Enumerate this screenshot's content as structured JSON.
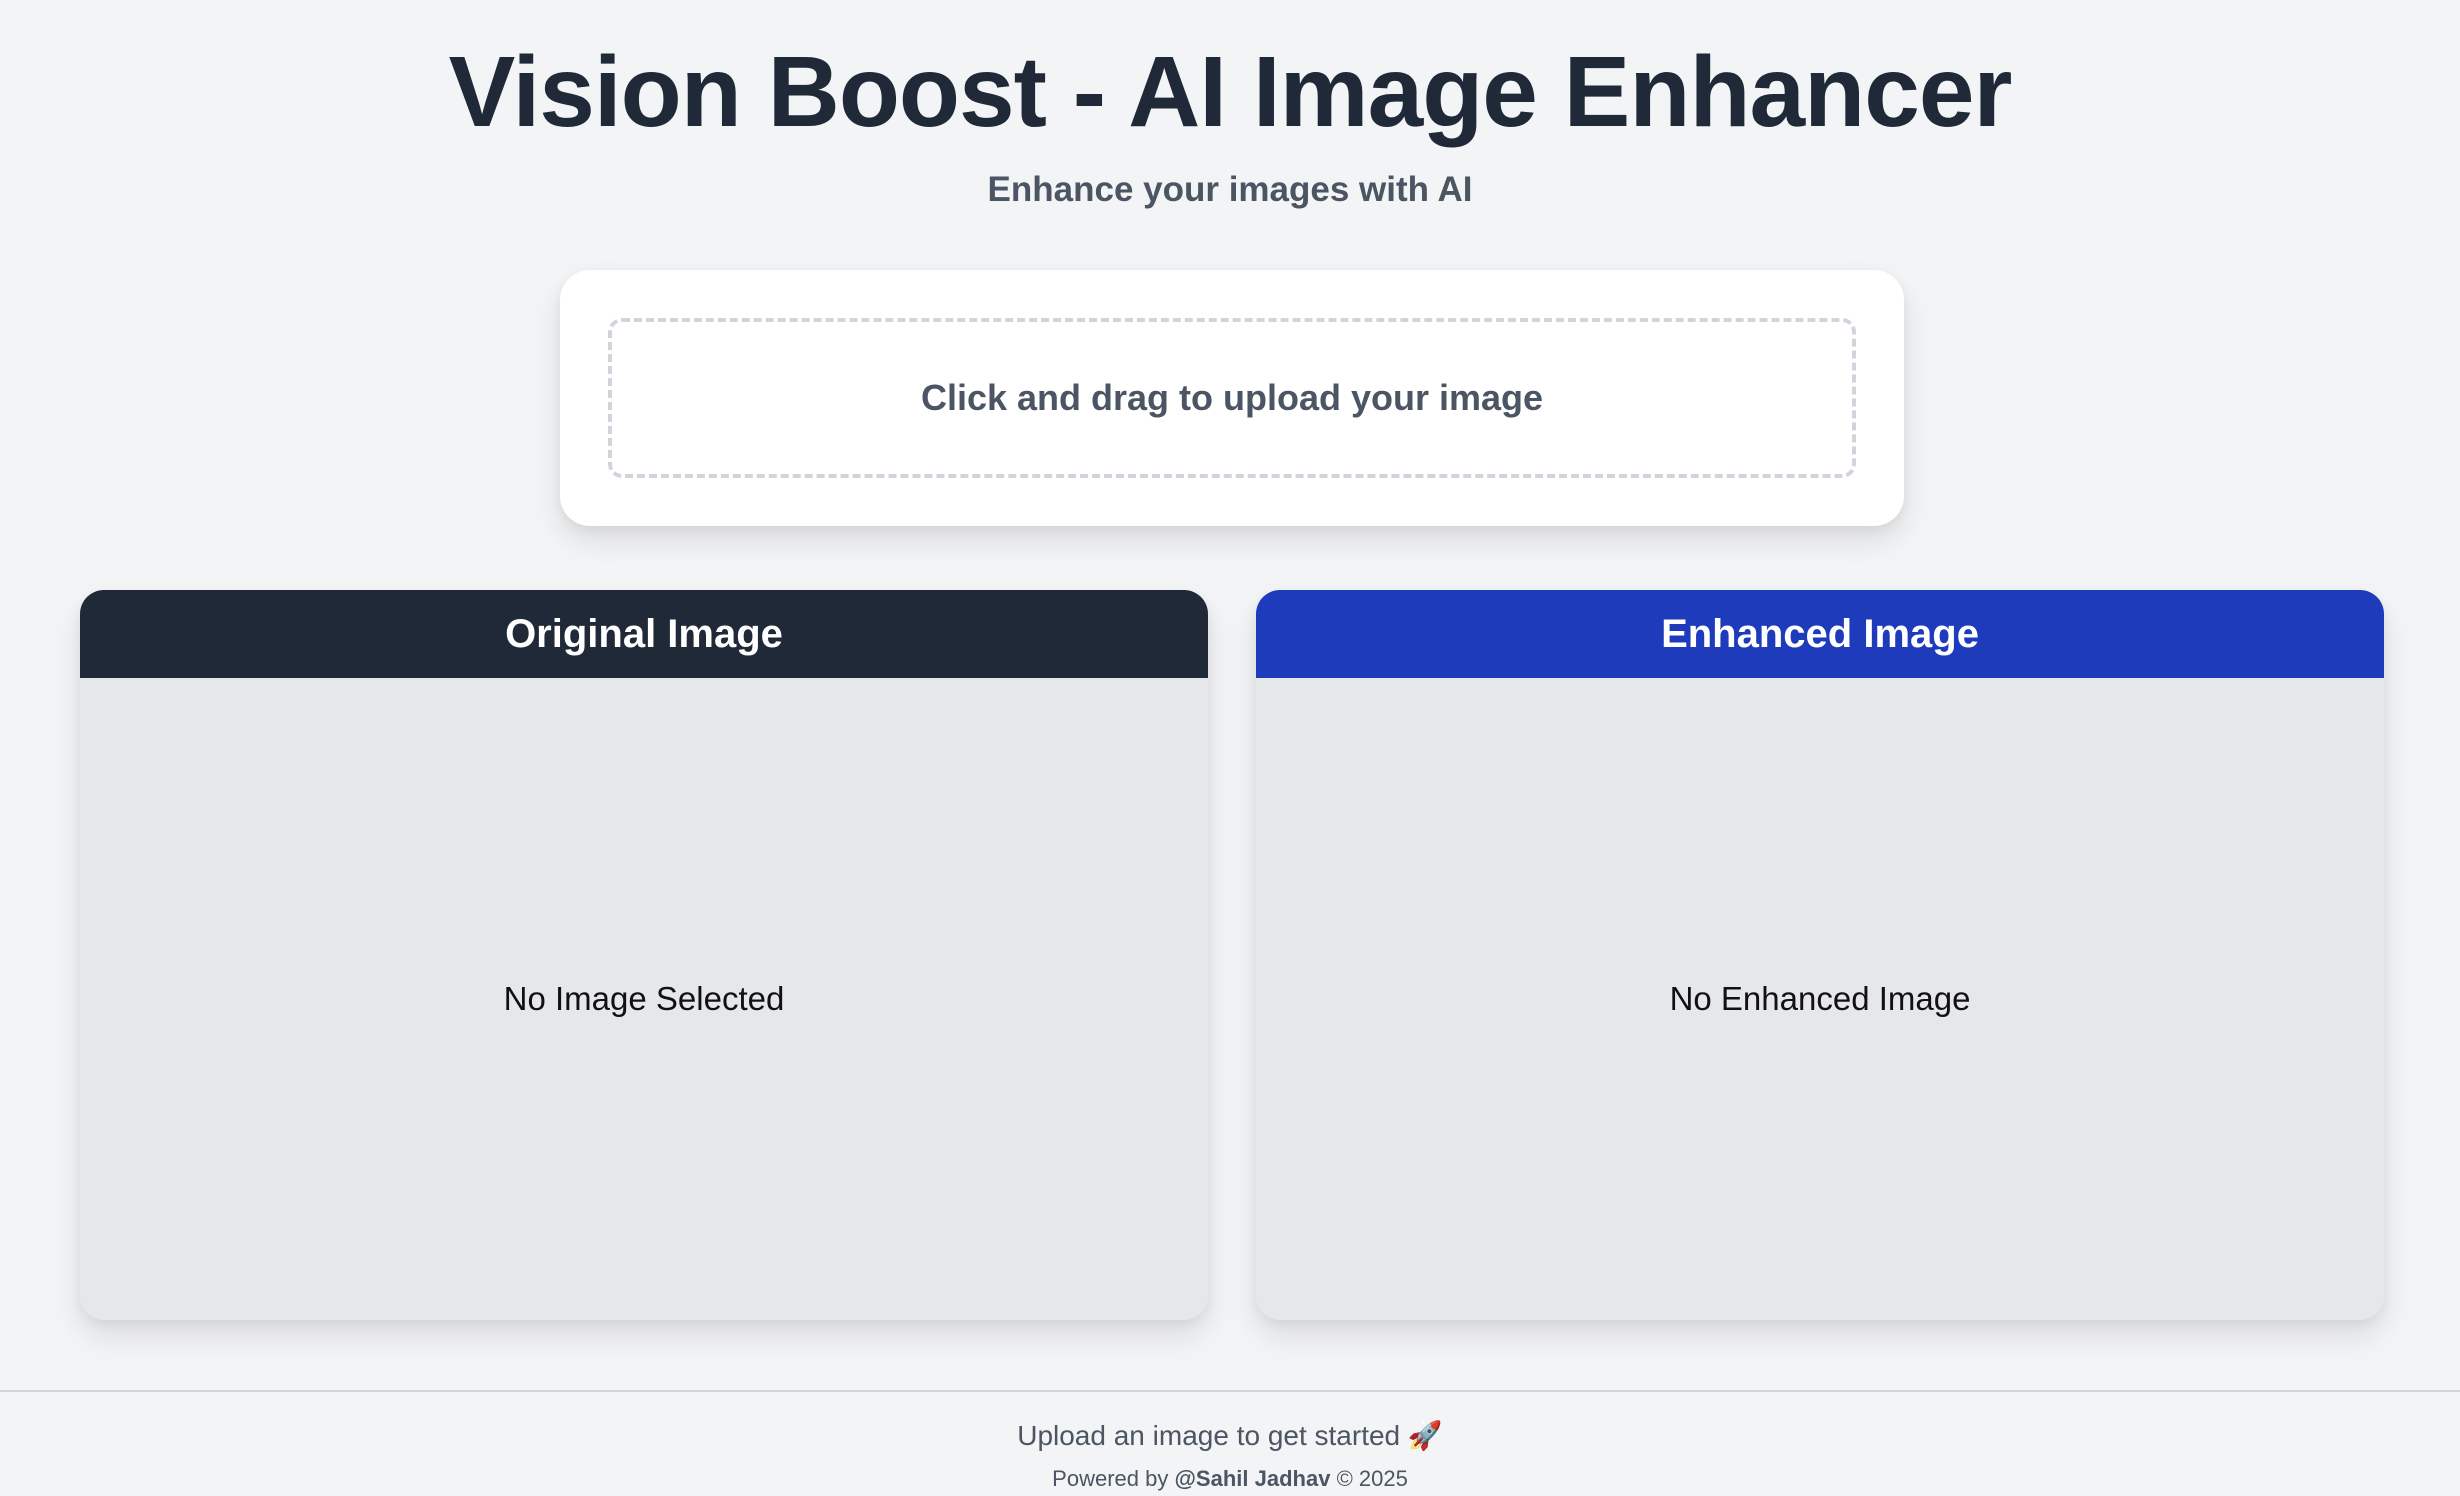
{
  "header": {
    "title": "Vision Boost - AI Image Enhancer",
    "subtitle": "Enhance your images with AI"
  },
  "upload": {
    "prompt": "Click and drag to upload your image"
  },
  "panels": {
    "original": {
      "title": "Original Image",
      "placeholder": "No Image Selected",
      "header_color": "#1f2937"
    },
    "enhanced": {
      "title": "Enhanced Image",
      "placeholder": "No Enhanced Image",
      "header_color": "#1d3bbb"
    }
  },
  "footer": {
    "status": "Upload an image to get started 🚀",
    "powered_prefix": "Powered by",
    "author": "@Sahil Jadhav",
    "copyright": "© 2025"
  },
  "colors": {
    "background": "#f3f4f6",
    "text_primary": "#1f2937",
    "text_secondary": "#4b5563",
    "panel_body": "#e5e7eb"
  }
}
